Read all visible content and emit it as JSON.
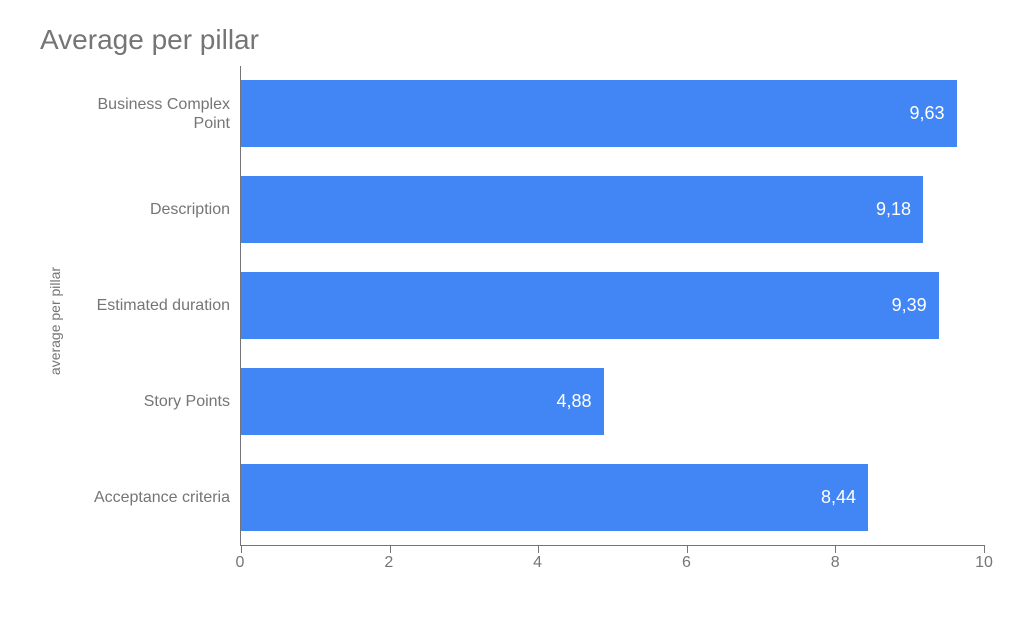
{
  "title": "Average per pillar",
  "yaxis_label": "average per pillar",
  "chart_data": {
    "type": "bar",
    "orientation": "horizontal",
    "categories": [
      "Business Complex Point",
      "Description",
      "Estimated duration",
      "Story Points",
      "Acceptance criteria"
    ],
    "values": [
      9.63,
      9.18,
      9.39,
      4.88,
      8.44
    ],
    "value_labels": [
      "9,63",
      "9,18",
      "9,39",
      "4,88",
      "8,44"
    ],
    "xticks": [
      0,
      2,
      4,
      6,
      8,
      10
    ],
    "xlim": [
      0,
      10
    ],
    "bar_color": "#4285f4",
    "title": "Average per pillar",
    "xlabel": "",
    "ylabel": "average per pillar"
  }
}
